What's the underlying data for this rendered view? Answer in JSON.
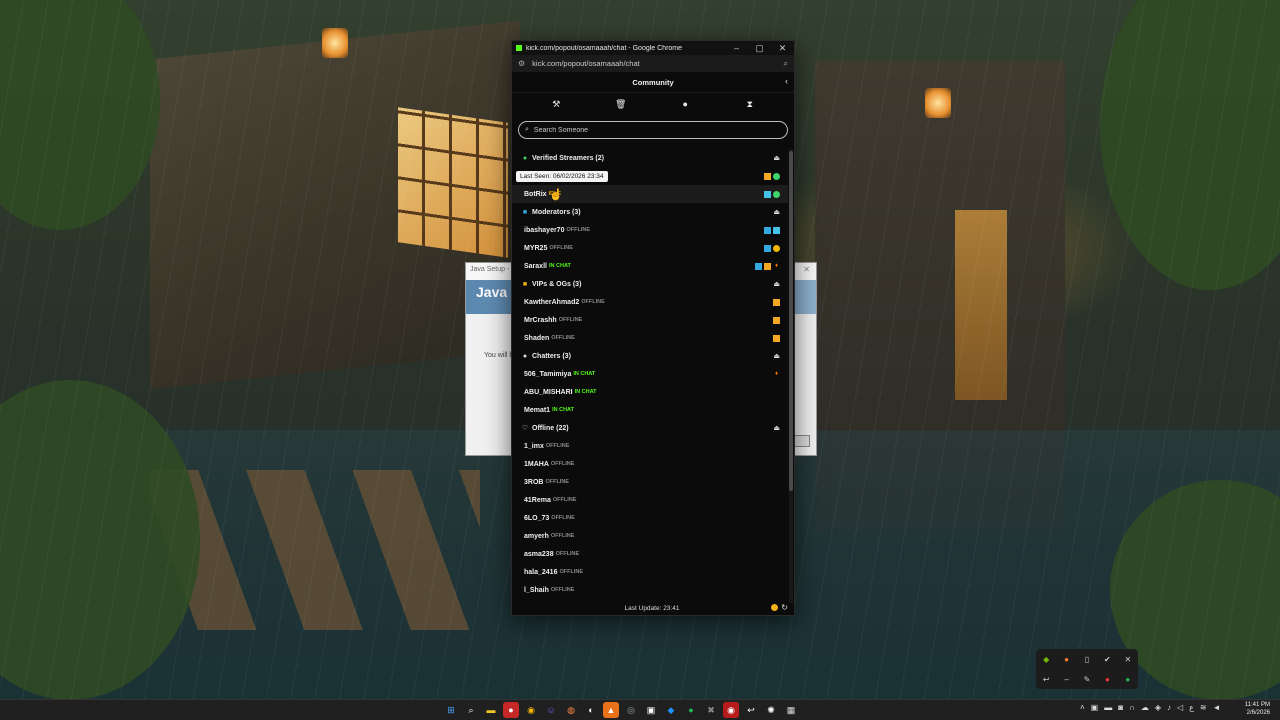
{
  "browser": {
    "window_title": "kick.com/popout/osamaaah/chat - Google Chrome",
    "url": "kick.com/popout/osamaaah/chat"
  },
  "panel": {
    "title": "Community",
    "search_placeholder": "Search Someone",
    "tooltip": "Last Seen: 06/02/2026 23:34",
    "footer": "Last Update: 23:41",
    "sections": {
      "verified": {
        "title": "Verified Streamers (2)",
        "users": [
          {
            "name": "BotRix",
            "status": "IDLE"
          }
        ]
      },
      "moderators": {
        "title": "Moderators (3)",
        "users": [
          {
            "name": "ibashayer70",
            "status": "OFFLINE"
          },
          {
            "name": "MYR25",
            "status": "OFFLINE"
          },
          {
            "name": "Saraxll",
            "status": "IN CHAT"
          }
        ]
      },
      "vips": {
        "title": "VIPs & OGs (3)",
        "users": [
          {
            "name": "KawtherAhmad2",
            "status": "OFFLINE"
          },
          {
            "name": "MrCrashh",
            "status": "OFFLINE"
          },
          {
            "name": "Shaden",
            "status": "OFFLINE"
          }
        ]
      },
      "chatters": {
        "title": "Chatters (3)",
        "users": [
          {
            "name": "506_Tamimiya",
            "status": "IN CHAT"
          },
          {
            "name": "ABU_MISHARI",
            "status": "IN CHAT"
          },
          {
            "name": "Memat1",
            "status": "IN CHAT"
          }
        ]
      },
      "offline": {
        "title": "Offline (22)",
        "users": [
          {
            "name": "1_imx",
            "status": "OFFLINE"
          },
          {
            "name": "1MAHA",
            "status": "OFFLINE"
          },
          {
            "name": "3ROB",
            "status": "OFFLINE"
          },
          {
            "name": "41Rema",
            "status": "OFFLINE"
          },
          {
            "name": "6LO_73",
            "status": "OFFLINE"
          },
          {
            "name": "amyerh",
            "status": "OFFLINE"
          },
          {
            "name": "asma238",
            "status": "OFFLINE"
          },
          {
            "name": "hala_2416",
            "status": "OFFLINE"
          },
          {
            "name": "l_Shaih",
            "status": "OFFLINE"
          }
        ]
      }
    }
  },
  "background_dialog": {
    "title": "Java Setup - Co",
    "banner": "Java",
    "text": "You will b"
  },
  "taskbar": {
    "time": "11:41 PM",
    "date": "2/6/2026",
    "lang": "ع"
  },
  "colors": {
    "kick_green": "#53fc18",
    "idle": "#e8a200",
    "offline": "#8a8a8a"
  }
}
